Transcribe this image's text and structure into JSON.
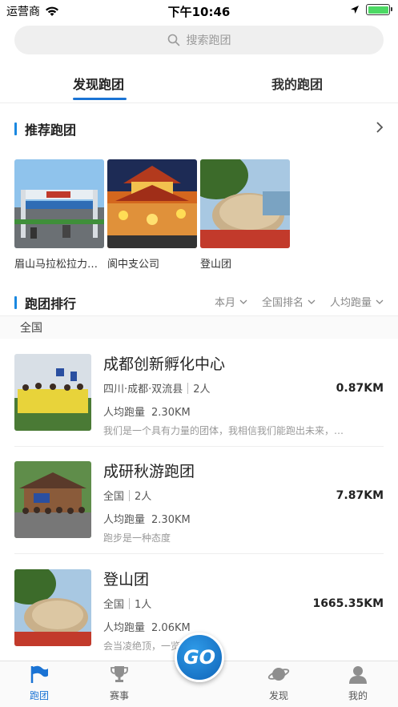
{
  "status": {
    "carrier": "运营商",
    "time": "下午10:46"
  },
  "search": {
    "placeholder": "搜索跑团"
  },
  "tabs": [
    {
      "label": "发现跑团"
    },
    {
      "label": "我的跑团"
    }
  ],
  "recommended": {
    "title": "推荐跑团",
    "items": [
      {
        "name": "眉山马拉松拉力赛跑团"
      },
      {
        "name": "阆中支公司"
      },
      {
        "name": "登山团"
      }
    ]
  },
  "ranking": {
    "title": "跑团排行",
    "filters": [
      {
        "label": "本月"
      },
      {
        "label": "全国排名"
      },
      {
        "label": "人均跑量"
      }
    ],
    "region": "全国",
    "clubs": [
      {
        "name": "成都创新孵化中心",
        "location": "四川·成都·双流县",
        "members": "2人",
        "distance": "0.87KM",
        "avg_label": "人均跑量",
        "avg_value": "2.30KM",
        "desc": "我们是一个具有力量的团体，我相信我们能跑出未来，…"
      },
      {
        "name": "成研秋游跑团",
        "location": "全国",
        "members": "2人",
        "distance": "7.87KM",
        "avg_label": "人均跑量",
        "avg_value": "2.30KM",
        "desc": "跑步是一种态度"
      },
      {
        "name": "登山团",
        "location": "全国",
        "members": "1人",
        "distance": "1665.35KM",
        "avg_label": "人均跑量",
        "avg_value": "2.06KM",
        "desc": "会当凌绝顶，一览众山小"
      }
    ]
  },
  "nav": {
    "items": [
      {
        "label": "跑团"
      },
      {
        "label": "赛事"
      },
      {
        "label": "发现"
      },
      {
        "label": "我的"
      }
    ],
    "go_label": "GO"
  },
  "colors": {
    "accent": "#1a73d4",
    "section_bar": "#1a88e0"
  }
}
